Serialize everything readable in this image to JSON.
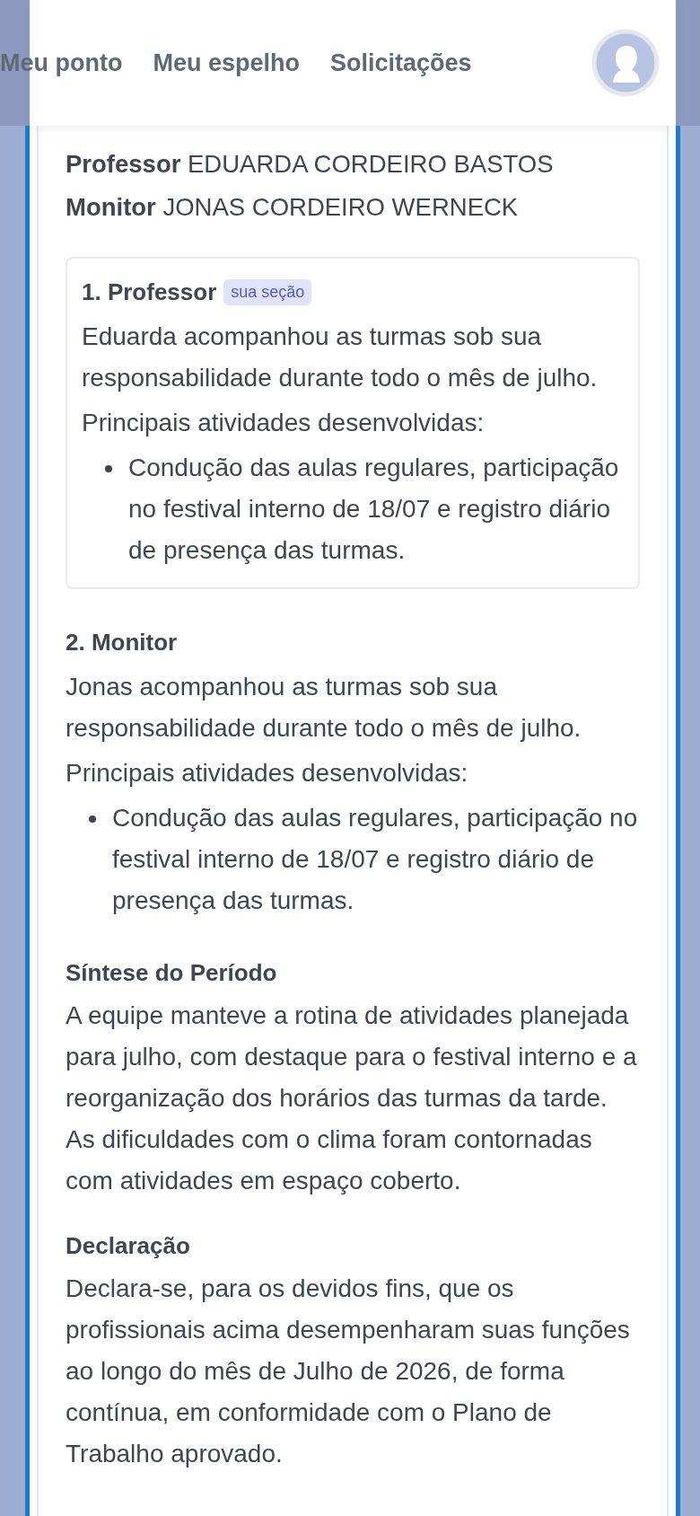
{
  "nav": {
    "items": [
      {
        "label": "Meu ponto"
      },
      {
        "label": "Meu espelho"
      },
      {
        "label": "Solicitações"
      }
    ]
  },
  "members": [
    {
      "role": "Professor",
      "name": "EDUARDA CORDEIRO BASTOS"
    },
    {
      "role": "Monitor",
      "name": "JONAS CORDEIRO WERNECK"
    }
  ],
  "sections": [
    {
      "title": "1. Professor",
      "badge": "sua seção",
      "highlighted": true,
      "summary": "Eduarda acompanhou as turmas sob sua responsabilidade durante todo o mês de julho.",
      "activities_label": "Principais atividades desenvolvidas:",
      "activities": [
        "Condução das aulas regulares, participação no festival interno de 18/07 e registro diário de presença das turmas."
      ]
    },
    {
      "title": "2. Monitor",
      "highlighted": false,
      "summary": "Jonas acompanhou as turmas sob sua responsabilidade durante todo o mês de julho.",
      "activities_label": "Principais atividades desenvolvidas:",
      "activities": [
        "Condução das aulas regulares, participação no festival interno de 18/07 e registro diário de presença das turmas."
      ]
    }
  ],
  "synthesis": {
    "title": "Síntese do Período",
    "text": "A equipe manteve a rotina de atividades planejada para julho, com destaque para o festival interno e a reorganização dos horários das turmas da tarde. As dificuldades com o clima foram contornadas com atividades em espaço coberto."
  },
  "declaration": {
    "title": "Declaração",
    "text": "Declara-se, para os devidos fins, que os profissionais acima desempenharam suas funções ao longo do mês de Julho de 2026, de forma contínua, em conformidade com o Plano de Trabalho aprovado."
  }
}
